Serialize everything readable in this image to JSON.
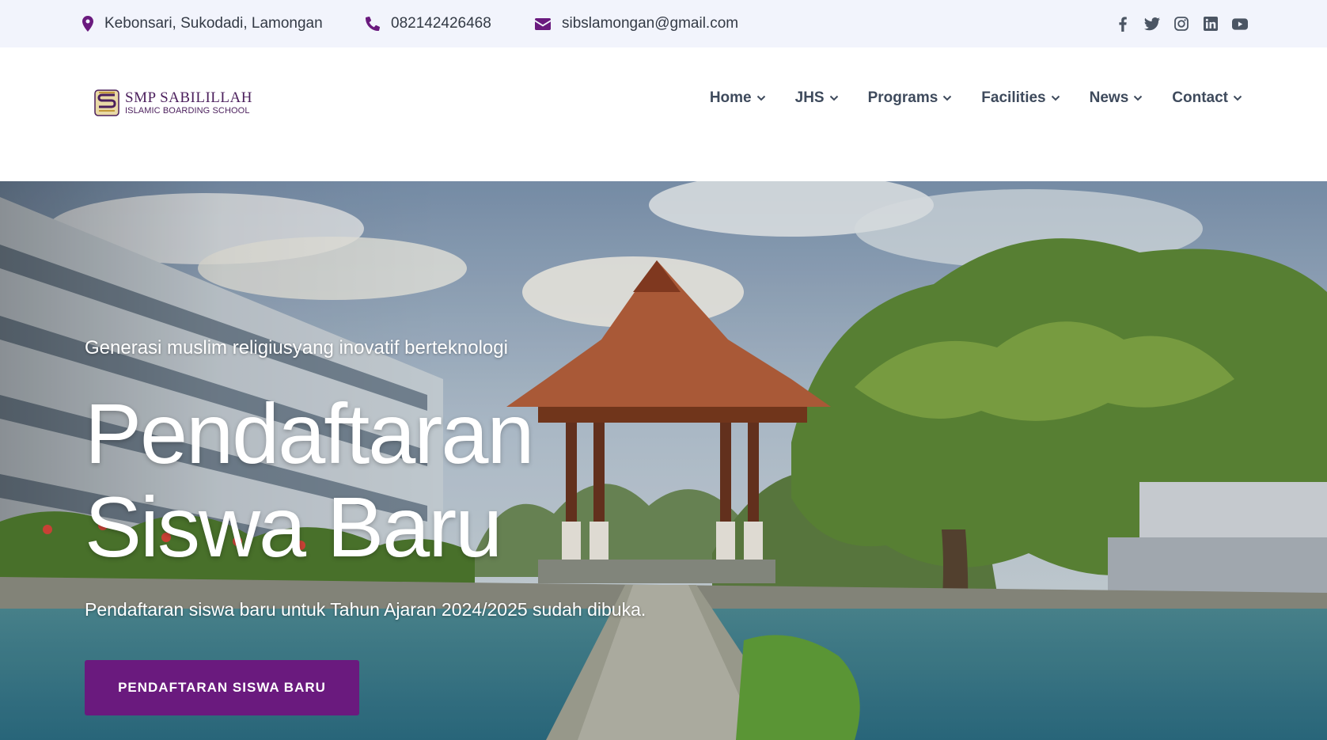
{
  "topbar": {
    "address": "Kebonsari, Sukodadi, Lamongan",
    "phone": "082142426468",
    "email": "sibslamongan@gmail.com",
    "icon_color": "#6a1a7e",
    "socials": [
      "facebook-icon",
      "twitter-icon",
      "instagram-icon",
      "linkedin-icon",
      "youtube-icon"
    ]
  },
  "header": {
    "logo_title": "SMP SABILILLAH",
    "logo_subtitle": "ISLAMIC BOARDING SCHOOL",
    "nav": [
      {
        "label": "Home"
      },
      {
        "label": "JHS"
      },
      {
        "label": "Programs"
      },
      {
        "label": "Facilities"
      },
      {
        "label": "News"
      },
      {
        "label": "Contact"
      }
    ]
  },
  "hero": {
    "tagline": "Generasi muslim religiusyang inovatif berteknologi",
    "title_line1": "Pendaftaran",
    "title_line2": "Siswa Baru",
    "description": "Pendaftaran siswa baru untuk Tahun Ajaran 2024/2025 sudah dibuka.",
    "button_label": "PENDAFTARAN SISWA BARU",
    "button_color": "#6a1a7e"
  }
}
